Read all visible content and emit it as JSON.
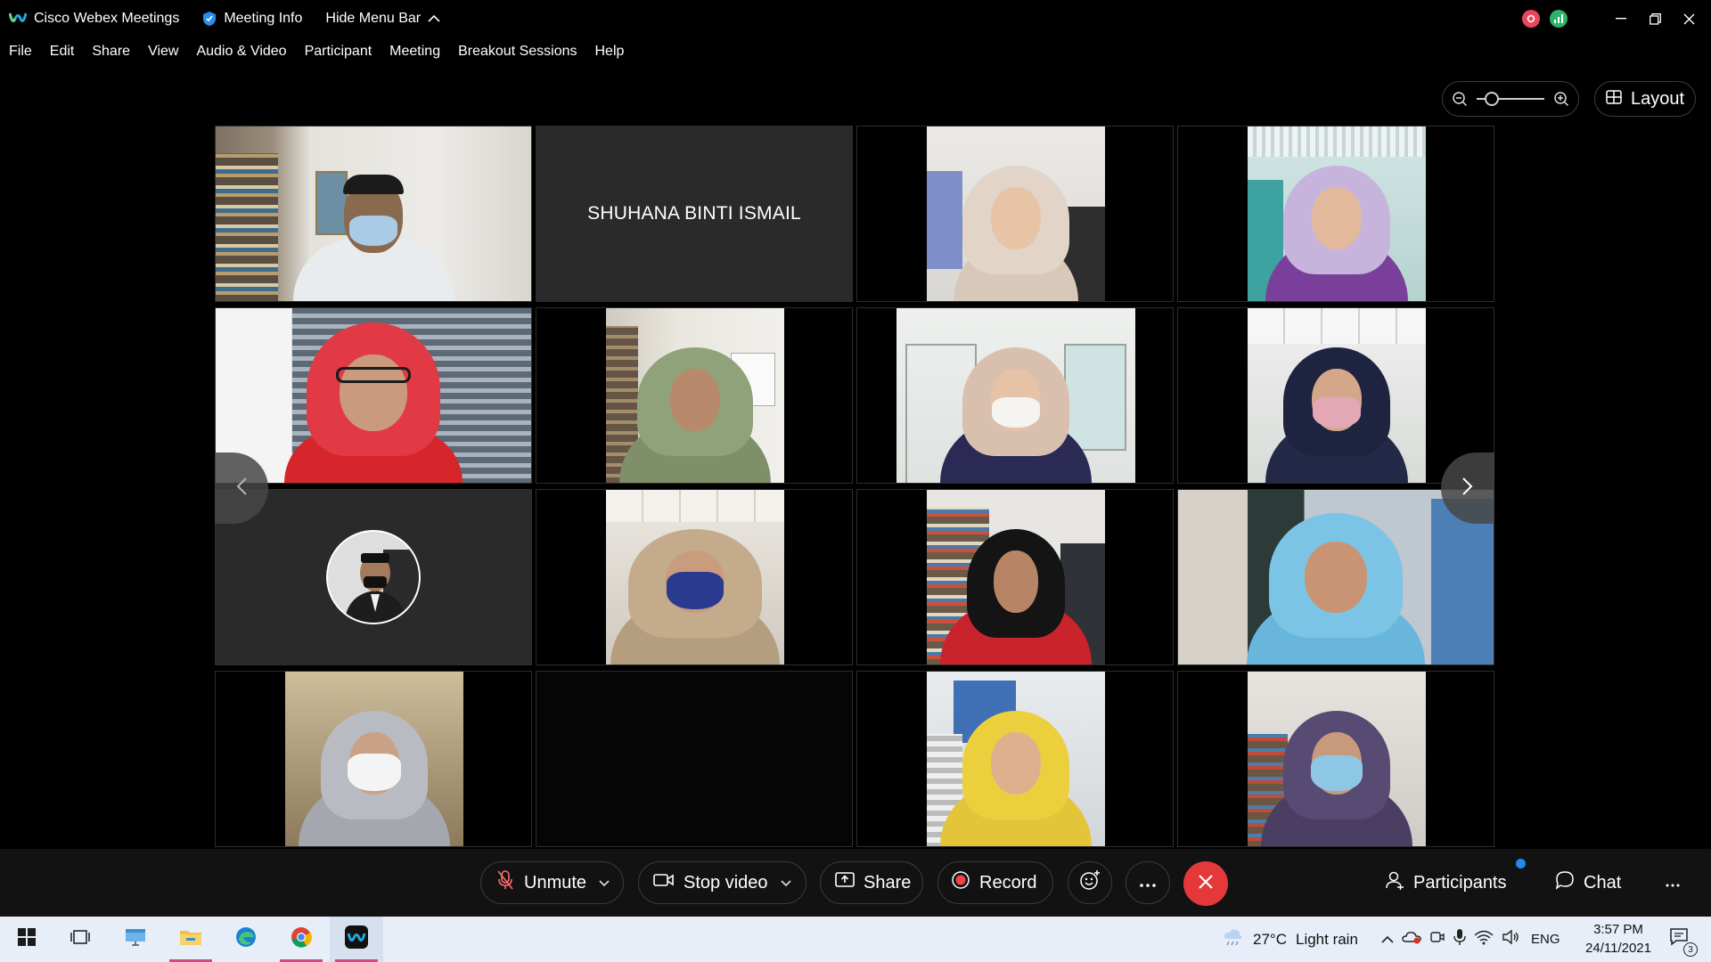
{
  "window": {
    "app_title": "Cisco Webex Meetings",
    "meeting_info": "Meeting Info",
    "hide_menu_bar": "Hide Menu Bar"
  },
  "menu": [
    "File",
    "Edit",
    "Share",
    "View",
    "Audio & Video",
    "Participant",
    "Meeting",
    "Breakout Sessions",
    "Help"
  ],
  "view_controls": {
    "layout_label": "Layout",
    "zoom_level": 0.15
  },
  "tiles": {
    "t2_name": "SHUHANA BINTI ISMAIL"
  },
  "controls": {
    "unmute": "Unmute",
    "stop_video": "Stop video",
    "share": "Share",
    "record": "Record",
    "participants": "Participants",
    "chat": "Chat"
  },
  "taskbar": {
    "weather_temp": "27°C",
    "weather_desc": "Light rain",
    "language": "ENG",
    "time": "3:57 PM",
    "date": "24/11/2021",
    "notification_count": "3"
  },
  "colors": {
    "end_call": "#e5383b",
    "badge": "#1f8af0",
    "taskbar_bg": "#e8eef8",
    "active_indicator": "#d6478a"
  }
}
